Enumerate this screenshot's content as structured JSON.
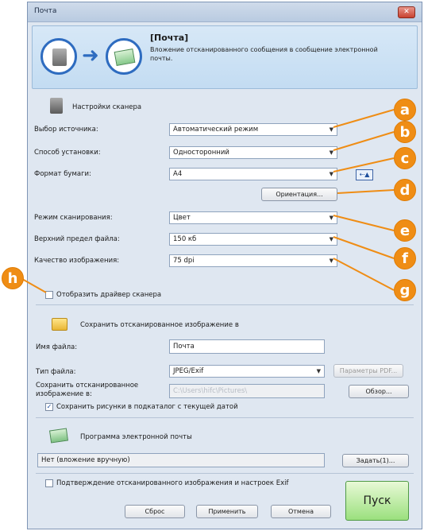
{
  "window": {
    "title": "Почта",
    "close_glyph": "✕"
  },
  "header": {
    "title": "[Почта]",
    "description": "Вложение отсканированного сообщения в сообщение электронной почты.",
    "arrow_glyph": "➜"
  },
  "scanner_settings": {
    "section_title": "Настройки сканера",
    "fields": [
      {
        "label": "Выбор источника:",
        "value": "Автоматический режим"
      },
      {
        "label": "Способ установки:",
        "value": "Односторонний"
      },
      {
        "label": "Формат бумаги:",
        "value": "A4"
      }
    ],
    "orientation_button": "Ориентация...",
    "fields2": [
      {
        "label": "Режим сканирования:",
        "value": "Цвет"
      },
      {
        "label": "Верхний предел файла:",
        "value": "150 кб"
      },
      {
        "label": "Качество изображения:",
        "value": "75 dpi"
      }
    ],
    "show_driver_label": "Отобразить драйвер сканера",
    "show_driver_checked": false,
    "caret_glyph": "▼"
  },
  "save_section": {
    "section_title": "Сохранить отсканированное изображение в",
    "file_name_label": "Имя файла:",
    "file_name_value": "Почта",
    "file_type_label": "Тип файла:",
    "file_type_value": "JPEG/Exif",
    "pdf_params_button": "Параметры PDF...",
    "save_path_label": "Сохранить отсканированное изображение в:",
    "save_path_value": "C:\\Users\\hifc\\Pictures\\",
    "browse_button": "Обзор...",
    "subfolder_label": "Сохранить рисунки в подкаталог с текущей датой",
    "subfolder_checked": true
  },
  "email_section": {
    "section_title": "Программа электронной почты",
    "program_value": "Нет (вложение вручную)",
    "set_button": "Задать(1)..."
  },
  "footer": {
    "confirm_label": "Подтверждение отсканированного изображения и настроек Exif",
    "confirm_checked": false,
    "reset_button": "Сброс",
    "apply_button": "Применить",
    "cancel_button": "Отмена",
    "start_button": "Пуск"
  },
  "callouts": [
    "a",
    "b",
    "c",
    "d",
    "e",
    "f",
    "g",
    "h"
  ],
  "colors": {
    "callout": "#ef8d15",
    "accent": "#2e6cc0",
    "start_button": "#9be07e"
  },
  "icons": [
    "scanner-icon",
    "arrow-icon",
    "email-icon",
    "folder-icon",
    "orientation-icon",
    "checkbox-icon"
  ]
}
